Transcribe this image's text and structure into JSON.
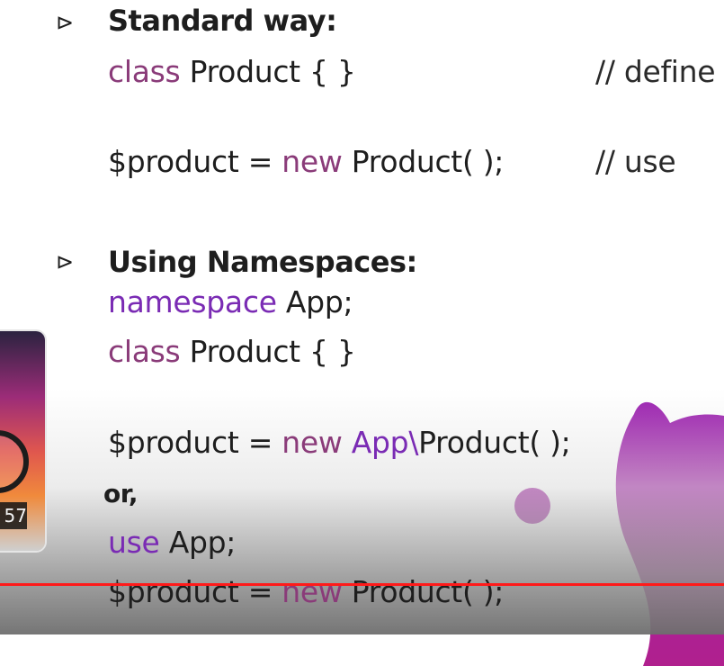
{
  "section1": {
    "title": "Standard way:",
    "line1": {
      "kw": "class",
      "rest": " Product { }",
      "comment": "// define"
    },
    "line2": {
      "pre": "$product = ",
      "kw": "new",
      "rest": " Product( );",
      "comment": "// use"
    }
  },
  "section2": {
    "title": "Using Namespaces:",
    "line1": {
      "kw": "namespace",
      "rest": " App;"
    },
    "line2": {
      "kw": "class",
      "rest": " Product { }"
    },
    "line3": {
      "pre": "$product = ",
      "kw": "new",
      "ns": " App\\",
      "rest": "Product( );"
    },
    "or_label": "or,",
    "line4": {
      "kw": "use",
      "rest": " App;"
    },
    "line5": {
      "pre": "$product = ",
      "kw": "new",
      "rest": " Product( );"
    }
  },
  "thumbnail": {
    "duration": "57"
  },
  "colors": {
    "keyword": "#8a3b79",
    "namespace_keyword": "#7a2bb4",
    "progress": "#ff1a1a",
    "accent": "#a01fa0"
  },
  "icons": {
    "bullet": "play-outline-icon",
    "thumb_logo": "wordpress-icon"
  }
}
